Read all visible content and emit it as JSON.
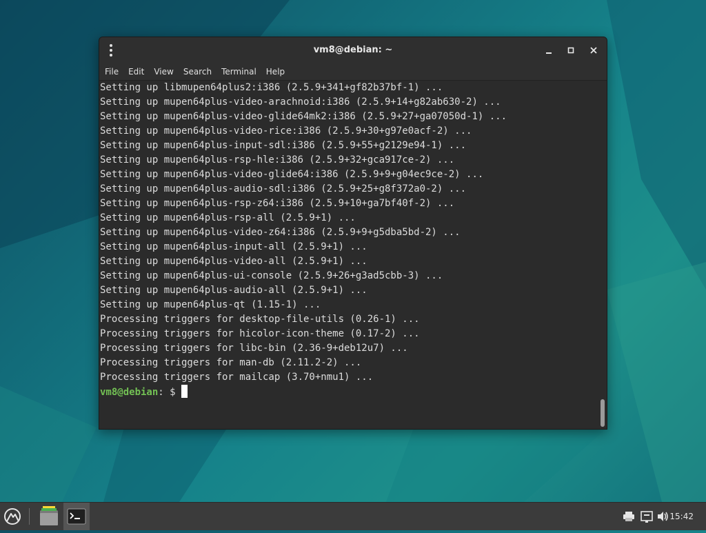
{
  "window": {
    "title": "vm8@debian: ~",
    "menu": [
      "File",
      "Edit",
      "View",
      "Search",
      "Terminal",
      "Help"
    ],
    "controls": {
      "minimize": "minimize-icon",
      "maximize": "maximize-icon",
      "close": "close-icon"
    }
  },
  "terminal": {
    "lines": [
      "Setting up libmupen64plus2:i386 (2.5.9+341+gf82b37bf-1) ...",
      "Setting up mupen64plus-video-arachnoid:i386 (2.5.9+14+g82ab630-2) ...",
      "Setting up mupen64plus-video-glide64mk2:i386 (2.5.9+27+ga07050d-1) ...",
      "Setting up mupen64plus-video-rice:i386 (2.5.9+30+g97e0acf-2) ...",
      "Setting up mupen64plus-input-sdl:i386 (2.5.9+55+g2129e94-1) ...",
      "Setting up mupen64plus-rsp-hle:i386 (2.5.9+32+gca917ce-2) ...",
      "Setting up mupen64plus-video-glide64:i386 (2.5.9+9+g04ec9ce-2) ...",
      "Setting up mupen64plus-audio-sdl:i386 (2.5.9+25+g8f372a0-2) ...",
      "Setting up mupen64plus-rsp-z64:i386 (2.5.9+10+ga7bf40f-2) ...",
      "Setting up mupen64plus-rsp-all (2.5.9+1) ...",
      "Setting up mupen64plus-video-z64:i386 (2.5.9+9+g5dba5bd-2) ...",
      "Setting up mupen64plus-input-all (2.5.9+1) ...",
      "Setting up mupen64plus-video-all (2.5.9+1) ...",
      "Setting up mupen64plus-ui-console (2.5.9+26+g3ad5cbb-3) ...",
      "Setting up mupen64plus-audio-all (2.5.9+1) ...",
      "Setting up mupen64plus-qt (1.15-1) ...",
      "Processing triggers for desktop-file-utils (0.26-1) ...",
      "Processing triggers for hicolor-icon-theme (0.17-2) ...",
      "Processing triggers for libc-bin (2.36-9+deb12u7) ...",
      "Processing triggers for man-db (2.11.2-2) ...",
      "Processing triggers for mailcap (3.70+nmu1) ..."
    ],
    "prompt_user": "vm8@debian",
    "prompt_rest": ": $ ",
    "colors": {
      "background": "#2b2b2b",
      "text": "#dcdcdc",
      "prompt": "#73c154"
    }
  },
  "taskbar": {
    "clock": "15:42",
    "icons": [
      "menu-logo-icon",
      "file-manager-icon",
      "terminal-icon",
      "printer-icon",
      "network-icon",
      "volume-icon"
    ]
  }
}
